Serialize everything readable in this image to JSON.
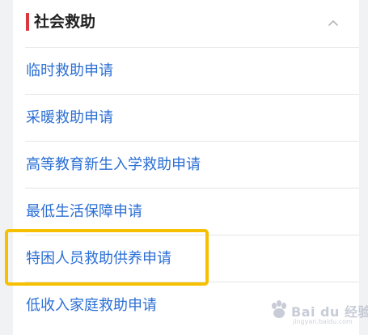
{
  "section": {
    "title": "社会救助",
    "accent_color": "#d9373e",
    "collapse_icon": "chevron-up-icon"
  },
  "items": [
    {
      "label": "临时救助申请"
    },
    {
      "label": "采暖救助申请"
    },
    {
      "label": "高等教育新生入学救助申请"
    },
    {
      "label": "最低生活保障申请"
    },
    {
      "label": "特困人员救助供养申请",
      "highlighted": true
    },
    {
      "label": "低收入家庭救助申请"
    }
  ],
  "colors": {
    "link": "#2b6fd4",
    "highlight": "#f6c000",
    "divider": "#e5e5e5"
  },
  "watermark": {
    "text": "Bai du 经验",
    "subtext": "jingyan.baidu.com"
  }
}
